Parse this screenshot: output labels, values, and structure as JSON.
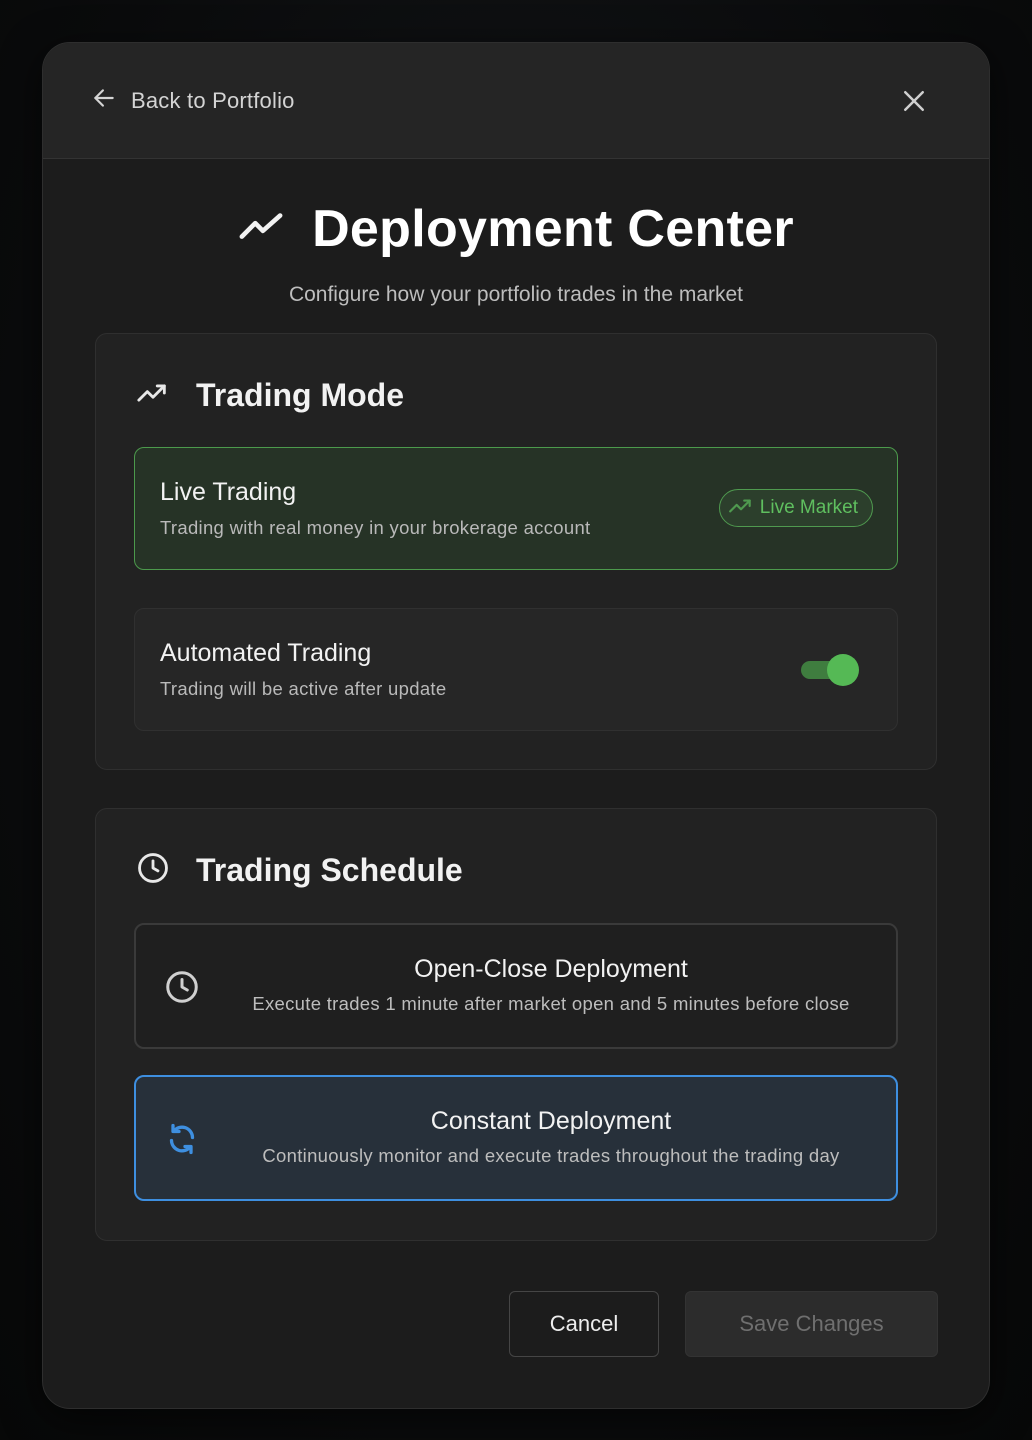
{
  "header": {
    "back_label": "Back to Portfolio"
  },
  "page": {
    "title": "Deployment Center",
    "subtitle": "Configure how your portfolio trades in the market"
  },
  "trading_mode": {
    "title": "Trading Mode",
    "live": {
      "title": "Live Trading",
      "description": "Trading with real money in your brokerage account",
      "badge": "Live Market"
    },
    "automated": {
      "title": "Automated Trading",
      "description": "Trading will be active after update",
      "enabled": true
    }
  },
  "trading_schedule": {
    "title": "Trading Schedule",
    "options": [
      {
        "title": "Open-Close Deployment",
        "description": "Execute trades 1 minute after market open and 5 minutes before close",
        "icon": "clock-icon",
        "selected": false
      },
      {
        "title": "Constant Deployment",
        "description": "Continuously monitor and execute trades throughout the trading day",
        "icon": "refresh-icon",
        "selected": true
      }
    ]
  },
  "footer": {
    "cancel_label": "Cancel",
    "save_label": "Save Changes"
  },
  "colors": {
    "accent_green": "#55b955",
    "accent_blue": "#3e8fe0",
    "background": "#1c1c1c"
  }
}
